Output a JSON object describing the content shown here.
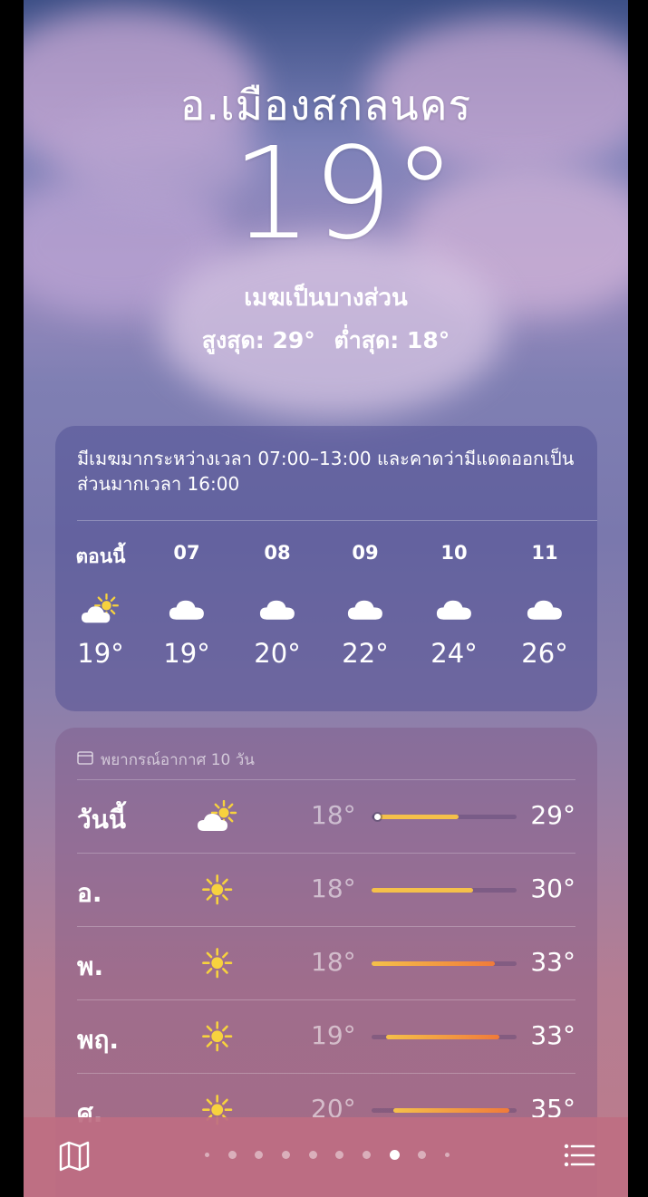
{
  "location": {
    "city": "อ.เมืองสกลนคร",
    "temperature": "19°",
    "condition": "เมฆเป็นบางส่วน",
    "high": "สูงสุด: 29°",
    "low": "ต่ำสุด: 18°"
  },
  "hourly": {
    "summary": "มีเมฆมากระหว่างเวลา 07:00–13:00 และคาดว่ามีแดดออกเป็นส่วนมากเวลา 16:00",
    "hours": [
      {
        "label": "ตอนนี้",
        "icon": "partly-cloudy-icon",
        "temp": "19°"
      },
      {
        "label": "07",
        "icon": "cloud-icon",
        "temp": "19°"
      },
      {
        "label": "08",
        "icon": "cloud-icon",
        "temp": "20°"
      },
      {
        "label": "09",
        "icon": "cloud-icon",
        "temp": "22°"
      },
      {
        "label": "10",
        "icon": "cloud-icon",
        "temp": "24°"
      },
      {
        "label": "11",
        "icon": "cloud-icon",
        "temp": "26°"
      }
    ]
  },
  "daily": {
    "header": "พยากรณ์อากาศ 10 วัน",
    "header_icon": "calendar-icon",
    "days": [
      {
        "name": "วันนี้",
        "icon": "partly-cloudy-icon",
        "low": "18°",
        "high": "29°",
        "range_start": 0.05,
        "range_end": 0.6,
        "show_now": true
      },
      {
        "name": "อ.",
        "icon": "sun-icon",
        "low": "18°",
        "high": "30°",
        "range_start": 0.0,
        "range_end": 0.7,
        "show_now": false
      },
      {
        "name": "พ.",
        "icon": "sun-icon",
        "low": "18°",
        "high": "33°",
        "range_start": 0.0,
        "range_end": 0.85,
        "show_now": false
      },
      {
        "name": "พฤ.",
        "icon": "sun-icon",
        "low": "19°",
        "high": "33°",
        "range_start": 0.1,
        "range_end": 0.88,
        "show_now": false
      },
      {
        "name": "ศ.",
        "icon": "sun-icon",
        "low": "20°",
        "high": "35°",
        "range_start": 0.15,
        "range_end": 0.95,
        "show_now": false
      }
    ]
  },
  "tabbar": {
    "map_icon": "map-icon",
    "list_icon": "list-icon",
    "page_count": 10,
    "active_page": 7
  },
  "colors": {
    "bar_warm": "#f5c04a",
    "bar_hot": "#f07a3a",
    "sun": "#f7d23e"
  }
}
